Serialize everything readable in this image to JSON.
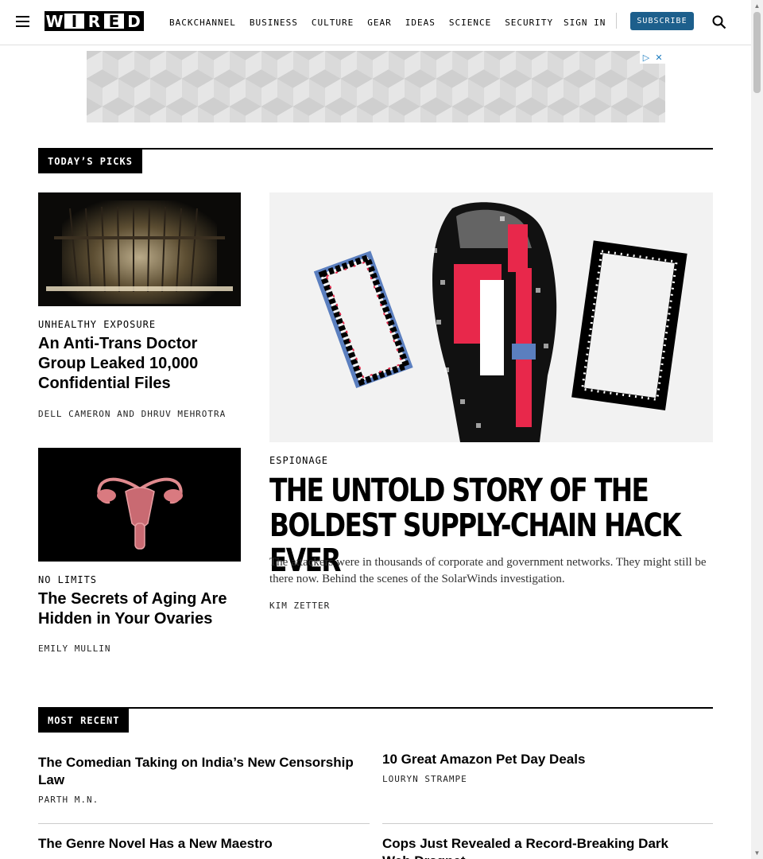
{
  "header": {
    "logo_letters": [
      "W",
      "I",
      "R",
      "E",
      "D"
    ],
    "nav": [
      "Backchannel",
      "Business",
      "Culture",
      "Gear",
      "Ideas",
      "Science",
      "Security"
    ],
    "signin_label": "Sign In",
    "subscribe_label": "Subscribe"
  },
  "ad": {
    "choices_icon": "▷",
    "close_icon": "✕"
  },
  "todays_picks": {
    "label": "Today’s Picks",
    "stories": [
      {
        "kicker": "Unhealthy Exposure",
        "headline": "An Anti-Trans Doctor Group Leaked 10,000 Confidential Files",
        "byline": "Dell Cameron and Dhruv Mehrotra"
      },
      {
        "kicker": "No Limits",
        "headline": "The Secrets of Aging Are Hidden in Your Ovaries",
        "byline": "Emily Mullin"
      }
    ],
    "feature": {
      "kicker": "Espionage",
      "headline": "THE UNTOLD STORY OF THE BOLDEST SUPPLY-CHAIN HACK EVER",
      "dek": "The attackers were in thousands of corporate and government networks. They might still be there now. Behind the scenes of the SolarWinds investigation.",
      "byline": "Kim Zetter"
    }
  },
  "most_recent": {
    "label": "Most Recent",
    "items": [
      {
        "headline": "The Comedian Taking on India’s New Censorship Law",
        "byline": "Parth M.N."
      },
      {
        "headline": "10 Great Amazon Pet Day Deals",
        "byline": "Louryn Strampe"
      },
      {
        "headline": "The Genre Novel Has a New Maestro",
        "byline": ""
      },
      {
        "headline": "Cops Just Revealed a Record-Breaking Dark Web Dragnet",
        "byline": ""
      }
    ]
  },
  "colors": {
    "subscribe": "#1d5f8c",
    "accent_red": "#e8284b",
    "accent_blue": "#5b7fbf"
  }
}
